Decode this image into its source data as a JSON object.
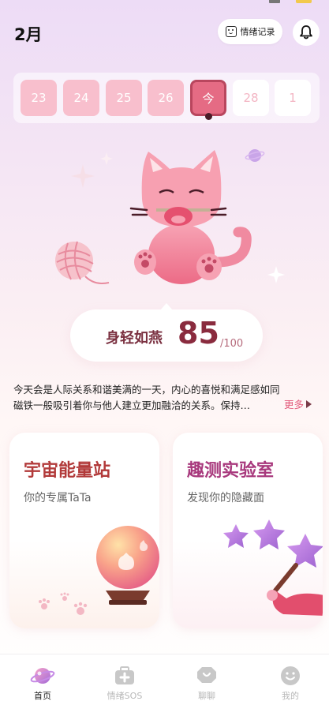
{
  "header": {
    "month": "2月",
    "mood_record_label": "情绪记录"
  },
  "date_strip": {
    "dates": [
      {
        "label": "23",
        "state": "past"
      },
      {
        "label": "24",
        "state": "past"
      },
      {
        "label": "25",
        "state": "past"
      },
      {
        "label": "26",
        "state": "past"
      },
      {
        "label": "今",
        "state": "today"
      },
      {
        "label": "28",
        "state": "future"
      },
      {
        "label": "1",
        "state": "future"
      }
    ]
  },
  "score": {
    "label": "身轻如燕",
    "value": "85",
    "max": "/100"
  },
  "fortune": {
    "line1": "今天会是人际关系和谐美满的一天，内心的喜悦和满足感如同",
    "line2": "磁铁一般吸引着你与他人建立更加融洽的关系。保持…",
    "more_label": "更多"
  },
  "cards": {
    "energy": {
      "title": "宇宙能量站",
      "subtitle": "你的专属TaTa"
    },
    "lab": {
      "title": "趣测实验室",
      "subtitle": "发现你的隐藏面"
    }
  },
  "tabbar": {
    "items": [
      {
        "label": "首页",
        "icon": "planet-icon",
        "active": true
      },
      {
        "label": "情绪SOS",
        "icon": "first-aid-kit-icon",
        "active": false
      },
      {
        "label": "聊聊",
        "icon": "chat-bubble-icon",
        "active": false
      },
      {
        "label": "我的",
        "icon": "smiley-face-icon",
        "active": false
      }
    ]
  },
  "colors": {
    "accent": "#e56b84",
    "score_text": "#8a2b3e",
    "more_link": "#e25a7b"
  }
}
